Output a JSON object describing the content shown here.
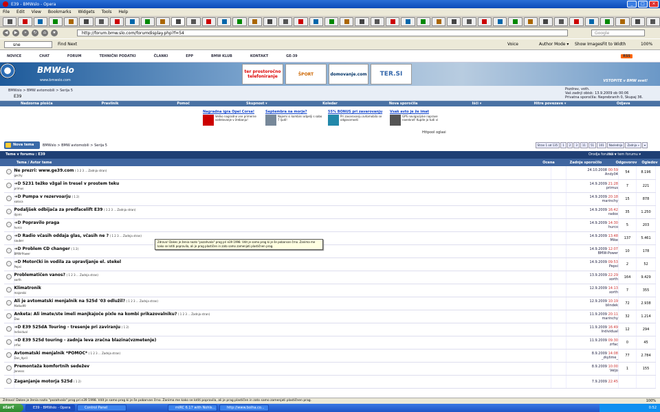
{
  "window": {
    "title": "E39 - BMWslo - Opera"
  },
  "menu": [
    "File",
    "Edit",
    "View",
    "Bookmarks",
    "Widgets",
    "Tools",
    "Help"
  ],
  "address": {
    "url": "http://forum.bmw.slo.com/forumdisplay.php?f=54",
    "search_placeholder": "Google"
  },
  "findbar": {
    "query": "sne",
    "find_next": "Find Next",
    "voice": "Voice",
    "author_mode": "Author Mode ▾",
    "show_images": "Show Images",
    "fit_to_width": "Fit to Width",
    "zoom": "100%"
  },
  "site": {
    "topnav": [
      "NOVICE",
      "CHAT",
      "FORUM",
      "TEHNIČNI PODATKI",
      "ČLANKI",
      "EPP",
      "BMW KLUB",
      "KONTAKT",
      "GE-39"
    ],
    "rss": "RSS",
    "logo_text": "BMWslo",
    "logo_url": "www.bmwslo.com",
    "ads": [
      "ter prostoročno telefoniranje",
      "ŠPORT",
      "domovanje.com",
      "TER.SI"
    ],
    "slogan": "VSTOPITE v BMW svet!",
    "breadcrumb": "BMWslo > BMW avtomobili > Serija 5",
    "forum": "E39",
    "user": {
      "greeting": "Pozdrav, voth.",
      "last_visit": "Vaš zadnji obisk: 13.9.2009 ob 00:06",
      "pm": "Privatna sporočila: Neprebranih 0, Skupaj 36."
    },
    "mainnav": [
      "Nadzorna plošča",
      "Pravilnik",
      "Pomoč",
      "Skupnost ▾",
      "Koledar",
      "Nova sporočila",
      "Išči ▾",
      "Hitre povezave ▾",
      "Odjava"
    ],
    "promos": [
      {
        "title": "Nagradna igra Opel Corsa!",
        "text": "Veliko nagradno vse primerne sodelovanje v žrebanju!"
      },
      {
        "title": "Septembra na morje?",
        "text": "Najemi si kombini odpelji s sabo 7 ljudi!"
      },
      {
        "title": "55% BONUS pri zavarovanju",
        "text": "Pri zavarovanju avtomobila se odgovornosti"
      },
      {
        "title": "Vsak avto je že imat",
        "text": "GPS navigacijske naprave naenkrat! Kupite jo tudi vi"
      }
    ],
    "httppool": "Httpool oglasi",
    "new_topic": "Nova tema",
    "action_crumb": "BMWslo > BMW avtomobili > Serija 5",
    "pager": [
      "Stran 1 od 135",
      "1",
      "2",
      "3",
      "11",
      "51",
      "101",
      "Naslednja",
      "Zadnja »",
      "▾"
    ],
    "forum_header": {
      "left": "Teme v forumu : E39",
      "tools": "Orodja foruma ▾",
      "search": "Išči v tem forumu ▾"
    },
    "columns": {
      "topic": "Tema / Avtor teme",
      "rating": "Ocena",
      "last_post": "Zadnje sporočilo",
      "replies": "Odgovorov",
      "views": "Ogledov"
    }
  },
  "threads": [
    {
      "title": "Ne prezri: www.ge39.com",
      "prefix": false,
      "pages": "( 1 2 3 ... Zadnja stran)",
      "author": "gechy",
      "date": "24.10.2008",
      "time": "00:59",
      "last": "Andy04",
      "replies": "54",
      "views": "8.196"
    },
    {
      "title": "5231 težko vžgal in tresel v prostem teku",
      "prefix": true,
      "pages": "",
      "author": "primus",
      "date": "14.9.2009",
      "time": "21:28",
      "last": "primus",
      "replies": "7",
      "views": "221"
    },
    {
      "title": "Pumpa v rezervoarju",
      "prefix": true,
      "pages": "( 1 2)",
      "author": "xaloca",
      "date": "14.9.2009",
      "time": "20:18",
      "last": "marinchy",
      "replies": "15",
      "views": "878"
    },
    {
      "title": "Podaljšek odbijača za predfacelift E39",
      "prefix": false,
      "pages": "( 1 2 3 ... Zadnja stran)",
      "author": "djomi",
      "date": "14.9.2009",
      "time": "16:42",
      "last": "radox",
      "replies": "35",
      "views": "1.250"
    },
    {
      "title": "Popravilo praga",
      "prefix": true,
      "pages": "",
      "author": "hurco",
      "date": "14.9.2009",
      "time": "14:30",
      "last": "hurco",
      "replies": "5",
      "views": "203"
    },
    {
      "title": "Radio včasih oddaja glas, včasih ne ?",
      "prefix": true,
      "pages": "( 1 2 3 ... Zadnja stran)",
      "author": "sauber",
      "date": "14.9.2009",
      "time": "13:48",
      "last": "Mike",
      "replies": "137",
      "views": "5.461"
    },
    {
      "title": "Problem CD changer",
      "prefix": true,
      "pages": "( 1 2)",
      "author": "BMW-Power",
      "date": "14.9.2009",
      "time": "12:07",
      "last": "BMW-Power",
      "replies": "10",
      "views": "178"
    },
    {
      "title": "Motorčki in vodila za upravljanje el. stekel",
      "prefix": true,
      "pages": "",
      "author": "Pepsi",
      "date": "14.9.2009",
      "time": "09:53",
      "last": "Pepsi",
      "replies": "2",
      "views": "52"
    },
    {
      "title": "Problematičen vanos?",
      "prefix": false,
      "pages": "( 1 2 3 ... Zadnja stran)",
      "author": "xorth",
      "date": "13.9.2009",
      "time": "22:29",
      "last": "xorth",
      "replies": "164",
      "views": "9.429"
    },
    {
      "title": "Klimatronik",
      "prefix": false,
      "pages": "",
      "author": "majorobi",
      "date": "12.9.2009",
      "time": "14:13",
      "last": "xorth",
      "replies": "7",
      "views": "355"
    },
    {
      "title": "Ali je avtomatski menjalnik na 525d '03 odlužil?",
      "prefix": false,
      "pages": "( 1 2 3 ... Zadnja stran)",
      "author": "Matko99",
      "date": "12.9.2009",
      "time": "10:19",
      "last": "blindek",
      "replies": "72",
      "views": "2.938"
    },
    {
      "title": "Anketa: Ali imate/ste imeli manjkajoče pixle na kombi prikazovalniku?",
      "prefix": false,
      "pages": "( 1 2 3 ... Zadnja stran)",
      "author": "Dao",
      "date": "11.9.2009",
      "time": "20:11",
      "last": "marinchy",
      "replies": "32",
      "views": "1.214"
    },
    {
      "title": "E39 525dA Touring - tresenje pri zaviranju",
      "prefix": true,
      "pages": "( 1 2)",
      "author": "Individual",
      "date": "11.9.2009",
      "time": "16:49",
      "last": "Individual",
      "replies": "12",
      "views": "294"
    },
    {
      "title": "E39 525d touring - zadnja leva zračna blazina(vzmetenje)",
      "prefix": true,
      "pages": "",
      "author": "zrfac",
      "date": "11.9.2009",
      "time": "09:30",
      "last": "zrfac",
      "replies": "0",
      "views": "45"
    },
    {
      "title": "Avtomatski menjalnik *POMOC*",
      "prefix": false,
      "pages": "( 1 2 3 ... Zadnja stran)",
      "author": "Don_April",
      "date": "8.9.2009",
      "time": "14:08",
      "last": "_zkylime_",
      "replies": "77",
      "views": "2.784"
    },
    {
      "title": "Premontaža komfortnih sedežev",
      "prefix": false,
      "pages": "",
      "author": "Janesss",
      "date": "8.9.2009",
      "time": "10:00",
      "last": "Veljo",
      "replies": "1",
      "views": "155"
    },
    {
      "title": "Zaganjanje motorja 525d",
      "prefix": false,
      "pages": "( 1 2)",
      "author": "",
      "date": "7.9.2009",
      "time": "22:45",
      "last": "",
      "replies": "",
      "views": ""
    }
  ],
  "tooltip": "Zdravo! Dakes je ženia nazlo \"pozahvala\" prog pri e39 1998. Vdit je samo prog ki je še pobarvan črno. Zanima me kako se lotiti popravila, ali je prag plastičen in zato samo zamenjati plastičnen prag.",
  "status": "Zdravo! Dakes je ženia nazlo \"pozahvala\" prog pri e39 1998. Vdit je samo prog ki je še pobarvan črno. Zanima me kako se lotiti popravila, ali je prag plastičen in zato samo zamenjati plastičnen prag.",
  "status_zoom": "100%",
  "taskbar": {
    "start": "start",
    "tasks": [
      "E39 - BMWslo - Opera",
      "Control Panel",
      "mIRC 6.17 with Nohls...",
      "http://www.bolha.co..."
    ],
    "clock": "0:52"
  }
}
